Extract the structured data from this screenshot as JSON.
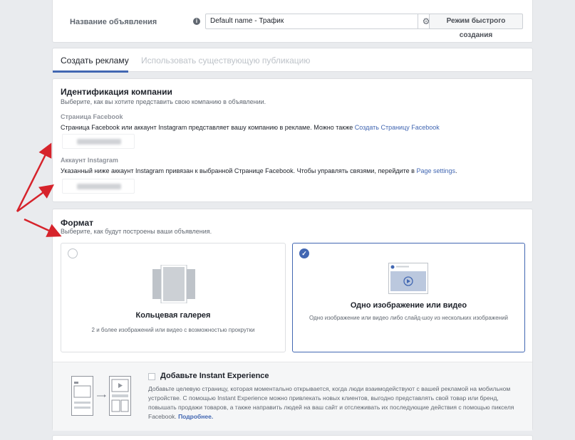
{
  "name_row": {
    "label": "Название объявления",
    "input_value": "Default name - Трафик",
    "quick_button": "Режим быстрого создания"
  },
  "tabs": {
    "active": "Создать рекламу",
    "inactive": "Использовать существующую публикацию"
  },
  "identity": {
    "title": "Идентификация компании",
    "subtitle": "Выберите, как вы хотите представить свою компанию в объявлении.",
    "facebook_label": "Страница Facebook",
    "facebook_text": "Страница Facebook или аккаунт Instagram представляет вашу компанию в рекламе. Можно также ",
    "facebook_link": "Создать Страницу Facebook",
    "instagram_label": "Аккаунт Instagram",
    "instagram_text": "Указанный ниже аккаунт Instagram привязан к выбранной Странице Facebook. Чтобы управлять связями, перейдите в ",
    "instagram_link": "Page settings",
    "instagram_end": "."
  },
  "format": {
    "title": "Формат",
    "subtitle": "Выберите, как будут построены ваши объявления.",
    "options": [
      {
        "title": "Кольцевая галерея",
        "desc": "2 и более изображений или видео с возможностью прокрутки",
        "selected": false
      },
      {
        "title": "Одно изображение или видео",
        "desc": "Одно изображение или видео либо слайд-шоу из нескольких изображений",
        "selected": true
      }
    ],
    "instant": {
      "title": "Добавьте Instant Experience",
      "text": "Добавьте целевую страницу, которая моментально открывается, когда люди взаимодействуют с вашей рекламой на мобильном устройстве. С помощью Instant Experience можно привлекать новых клиентов, выгодно представлять свой товар или бренд, повышать продажи товаров, а также направить людей на ваш сайт и отслеживать их последующие действия с помощью пикселя Facebook. ",
      "more": "Подробнее."
    }
  },
  "colors": {
    "accent": "#4267b2",
    "arrow": "#d6232b"
  }
}
